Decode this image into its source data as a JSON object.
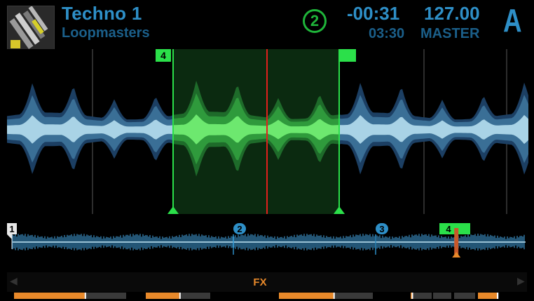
{
  "header": {
    "title": "Techno 1",
    "artist": "Loopmasters",
    "deck_number": "2",
    "time_remaining": "-00:31",
    "time_total": "03:30",
    "bpm": "127.00",
    "tempo_source": "MASTER",
    "deck_letter": "A"
  },
  "loop": {
    "in_marker_label": "4"
  },
  "overview": {
    "cue_labels": [
      "1",
      "2",
      "3",
      "4"
    ],
    "playhead_fraction": 0.865
  },
  "fx": {
    "label": "FX",
    "levels": [
      0.63,
      0.52,
      0.58,
      0.05,
      0.0,
      0.0,
      0.9
    ]
  },
  "colors": {
    "accent_blue": "#2e8fc7",
    "dim_blue": "#1b5f8a",
    "loop_green": "#1fdc3c",
    "playhead_red": "#e2201d",
    "fx_orange": "#e8892a"
  },
  "icons": {
    "cover_art": "album-cover-icon",
    "fx_left": "chevron-left-icon",
    "fx_right": "chevron-right-icon"
  }
}
